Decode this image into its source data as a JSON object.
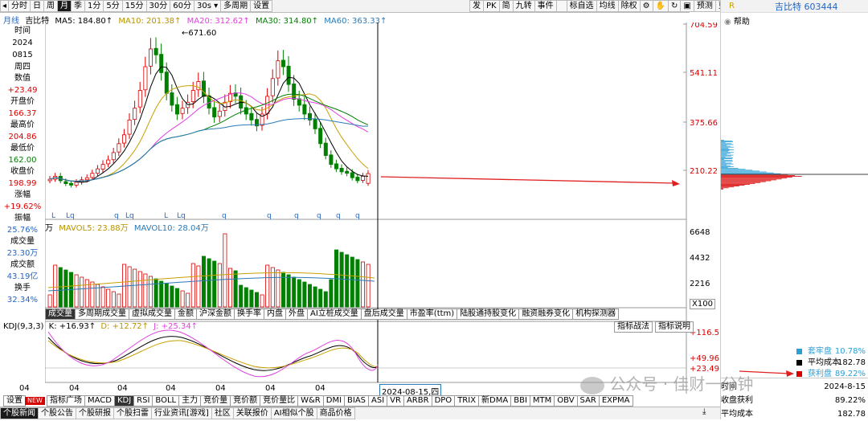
{
  "toolbar": {
    "periods": [
      "分时",
      "日",
      "周",
      "月",
      "季",
      "1分",
      "5分",
      "15分",
      "30分",
      "60分",
      "30s",
      "多周期",
      "设置"
    ],
    "period_dropdown": "30s",
    "active_period": "月",
    "right_buttons": [
      "发",
      "PK",
      "简",
      "九转",
      "事件",
      "标自选",
      "均线",
      "除权",
      "预测",
      "更多"
    ]
  },
  "legend_main": {
    "mode": "月线",
    "name": "吉比特",
    "ma5": "MA5: 184.80↑",
    "ma10": "MA10: 201.38↑",
    "ma20": "MA20: 312.62↑",
    "ma30": "MA30: 314.80↑",
    "ma60": "MA60: 363.33↑"
  },
  "info_panel": {
    "items": [
      {
        "label": "时间",
        "value": "2024"
      },
      {
        "label": "",
        "value": "0815"
      },
      {
        "label": "",
        "value": "周四"
      },
      {
        "label": "数值",
        "value": "+23.49"
      },
      {
        "label": "开盘价",
        "value": "166.37"
      },
      {
        "label": "最高价",
        "value": "204.86"
      },
      {
        "label": "最低价",
        "value": "162.00"
      },
      {
        "label": "收盘价",
        "value": "198.99"
      },
      {
        "label": "涨幅",
        "value": "+19.62%"
      },
      {
        "label": "振幅",
        "value": "25.76%"
      },
      {
        "label": "成交量",
        "value": "23.30万"
      },
      {
        "label": "成交额",
        "value": "43.19亿"
      },
      {
        "label": "换手",
        "value": "32.34%"
      }
    ]
  },
  "price_axis": [
    "704.59",
    "541.11",
    "375.66",
    "210.22"
  ],
  "price_peak": "671.60",
  "volume_legend": {
    "unit": "万",
    "mavol5": "MAVOL5: 23.88万",
    "mavol10": "MAVOL10: 28.04万"
  },
  "volume_axis": [
    "6648",
    "4432",
    "2216"
  ],
  "volume_multiplier": "X100",
  "indicator_tabs": [
    "成交量",
    "多周期成交量",
    "虚拟成交量",
    "金额",
    "沪深金额",
    "换手率",
    "内盘",
    "外盘",
    "AI立桩成交量",
    "盘后成交量",
    "市盈率(ttm)",
    "陆股通持股变化",
    "融资融券变化",
    "机构探测器"
  ],
  "kdj_legend": {
    "name": "KDJ(9,3,3)",
    "k": "K: +16.93↑",
    "d": "D: +12.72↑",
    "j": "J: +25.34↑"
  },
  "kdj_buttons": [
    "指标战法",
    "指标说明"
  ],
  "kdj_axis": [
    "+116.5",
    "+49.96",
    "+23.49"
  ],
  "x_axis_labels": [
    "04",
    "04",
    "04",
    "04",
    "04",
    "04",
    "04"
  ],
  "cursor_date": "2024-08-15,四",
  "indicator_bar": [
    "设置",
    "NEW",
    "指标广场",
    "MACD",
    "KDJ",
    "RSI",
    "BOLL",
    "主力",
    "竞价量",
    "竞价额",
    "竞价量比",
    "W&R",
    "DMI",
    "BIAS",
    "ASI",
    "VR",
    "ARBR",
    "DPO",
    "TRIX",
    "新DMA",
    "BBI",
    "MTM",
    "OBV",
    "SAR",
    "EXPMA"
  ],
  "active_indicator": "KDJ",
  "bottom_tabs": [
    "个股新闻",
    "个股公告",
    "个股研报",
    "个股扫雷",
    "行业资讯[游戏]",
    "社区",
    "关联报价",
    "AI相似个股",
    "商品价格"
  ],
  "right_panel": {
    "badge": "R",
    "title": "吉比特 603444",
    "help": "帮助",
    "legend": [
      {
        "name": "套牢盘",
        "value": "10.78%",
        "color": "#2a9fd6"
      },
      {
        "name": "平均成本",
        "value": "182.78",
        "color": "#000000"
      },
      {
        "name": "获利盘",
        "value": "89.22%",
        "color": "#d90000"
      }
    ],
    "table": [
      {
        "label": "时间",
        "value": "2024-8-15"
      },
      {
        "label": "收盘获利",
        "value": "89.22%"
      },
      {
        "label": "平均成本",
        "value": "182.78"
      }
    ]
  },
  "watermark": "公众号 · 佳财一分钟",
  "kline_markers": [
    "L",
    "Lq",
    "q",
    "Lq",
    "L",
    "Lq",
    "q",
    "q",
    "q",
    "q",
    "q",
    "q"
  ],
  "td_counts_label": [
    "7",
    "8",
    "9",
    "1",
    "2",
    "3",
    "4",
    "5",
    "6",
    "7",
    "8",
    "9",
    "45",
    "67",
    "123",
    "4",
    "5",
    "6",
    "7",
    "8",
    "1",
    "23",
    "4",
    "5",
    "6",
    "45",
    "7",
    "8",
    "9"
  ],
  "colors": {
    "up": "#d90000",
    "down": "#008000",
    "ma5": "#000000",
    "ma10": "#c8a000",
    "ma20": "#e040e0",
    "ma30": "#008000",
    "ma60": "#2a7ab8"
  }
}
